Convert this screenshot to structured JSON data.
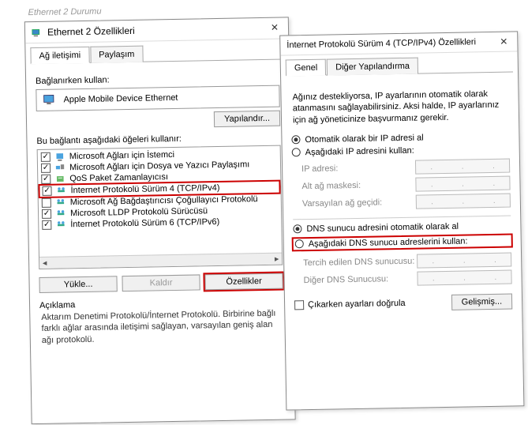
{
  "bg_window_title": "Ethernet 2 Durumu",
  "left": {
    "title": "Ethernet 2 Özellikleri",
    "tabs": [
      "Ağ iletişimi",
      "Paylaşım"
    ],
    "connect_label": "Bağlanırken kullan:",
    "adapter": "Apple Mobile Device Ethernet",
    "configure_btn": "Yapılandır...",
    "uses_label": "Bu bağlantı aşağıdaki öğeleri kullanır:",
    "items": [
      {
        "label": "Microsoft Ağları için İstemci",
        "checked": true,
        "icon": "client"
      },
      {
        "label": "Microsoft Ağları için Dosya ve Yazıcı Paylaşımı",
        "checked": true,
        "icon": "share"
      },
      {
        "label": "QoS Paket Zamanlayıcısı",
        "checked": true,
        "icon": "qos"
      },
      {
        "label": "İnternet Protokolü Sürüm 4 (TCP/IPv4)",
        "checked": true,
        "icon": "net",
        "highlight": true
      },
      {
        "label": "Microsoft Ağ Bağdaştırıcısı Çoğullayıcı Protokolü",
        "checked": false,
        "icon": "net"
      },
      {
        "label": "Microsoft LLDP Protokolü Sürücüsü",
        "checked": true,
        "icon": "net"
      },
      {
        "label": "İnternet Protokolü Sürüm 6 (TCP/IPv6)",
        "checked": true,
        "icon": "net"
      }
    ],
    "install_btn": "Yükle...",
    "remove_btn": "Kaldır",
    "properties_btn": "Özellikler",
    "desc_label": "Açıklama",
    "desc_text": "Aktarım Denetimi Protokolü/İnternet Protokolü. Birbirine bağlı farklı ağlar arasında iletişimi sağlayan, varsayılan geniş alan ağı protokolü."
  },
  "right": {
    "title": "İnternet Protokolü Sürüm 4 (TCP/IPv4) Özellikleri",
    "tabs": [
      "Genel",
      "Diğer Yapılandırma"
    ],
    "info": "Ağınız destekliyorsa, IP ayarlarının otomatik olarak atanmasını sağlayabilirsiniz. Aksi halde, IP ayarlarınız için ağ yöneticinize başvurmanız gerekir.",
    "ip_auto": "Otomatik olarak bir IP adresi al",
    "ip_manual": "Aşağıdaki IP adresini kullan:",
    "ip_fields": {
      "ip": "IP adresi:",
      "mask": "Alt ağ maskesi:",
      "gw": "Varsayılan ağ geçidi:"
    },
    "dns_auto": "DNS sunucu adresini otomatik olarak al",
    "dns_manual": "Aşağıdaki DNS sunucu adreslerini kullan:",
    "dns_fields": {
      "pref": "Tercih edilen DNS sunucusu:",
      "alt": "Diğer DNS Sunucusu:"
    },
    "validate": "Çıkarken ayarları doğrula",
    "advanced_btn": "Gelişmiş..."
  }
}
